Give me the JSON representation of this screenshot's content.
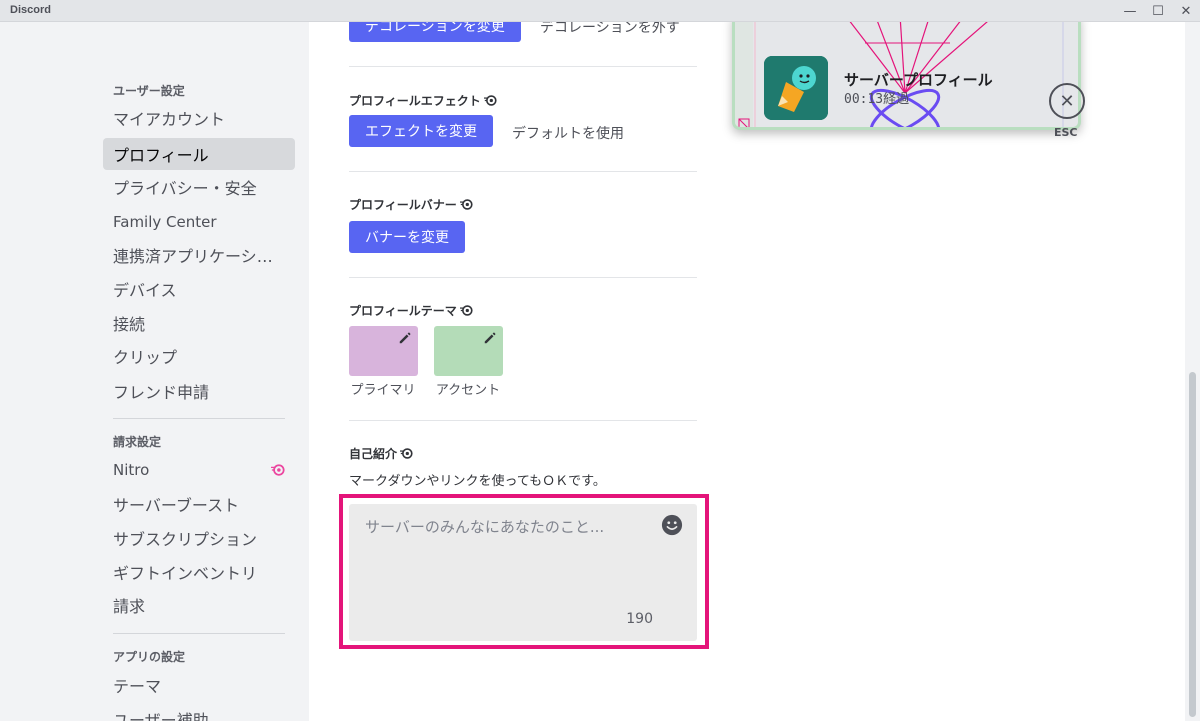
{
  "window": {
    "title": "Discord",
    "controls": {
      "minimize": "—",
      "maximize": "☐",
      "close": "✕"
    }
  },
  "sidebar": {
    "user_settings_header": "ユーザー設定",
    "user_items": [
      "マイアカウント",
      "プロフィール",
      "プライバシー・安全",
      "Family Center",
      "連携済アプリケーション",
      "デバイス",
      "接続",
      "クリップ",
      "フレンド申請"
    ],
    "selected_item": "プロフィール",
    "billing_header": "請求設定",
    "billing_items": [
      "Nitro",
      "サーバーブースト",
      "サブスクリプション",
      "ギフトインベントリ",
      "請求"
    ],
    "app_header": "アプリの設定",
    "app_items": [
      "テーマ",
      "ユーザー補助"
    ]
  },
  "content": {
    "decoration": {
      "change_label": "デコレーションを変更",
      "remove_label": "デコレーションを外す"
    },
    "effect": {
      "title": "プロフィールエフェクト",
      "change_label": "エフェクトを変更",
      "default_label": "デフォルトを使用"
    },
    "banner": {
      "title": "プロフィールバナー",
      "change_label": "バナーを変更"
    },
    "theme": {
      "title": "プロフィールテーマ",
      "primary_label": "プライマリ",
      "accent_label": "アクセント",
      "primary_color": "#d8b4dc",
      "accent_color": "#b4dcb8"
    },
    "bio": {
      "title": "自己紹介",
      "description": "マークダウンやリンクを使ってもＯＫです。",
      "placeholder": "サーバーのみんなにあなたのこと...",
      "remaining": "190"
    }
  },
  "preview": {
    "title": "サーバープロフィール",
    "elapsed": "00:13経過"
  },
  "close": {
    "icon": "close-icon",
    "esc_label": "ESC"
  },
  "colors": {
    "accent": "#5865f2",
    "highlight": "#e4147a",
    "nitro": "#eb459f"
  }
}
